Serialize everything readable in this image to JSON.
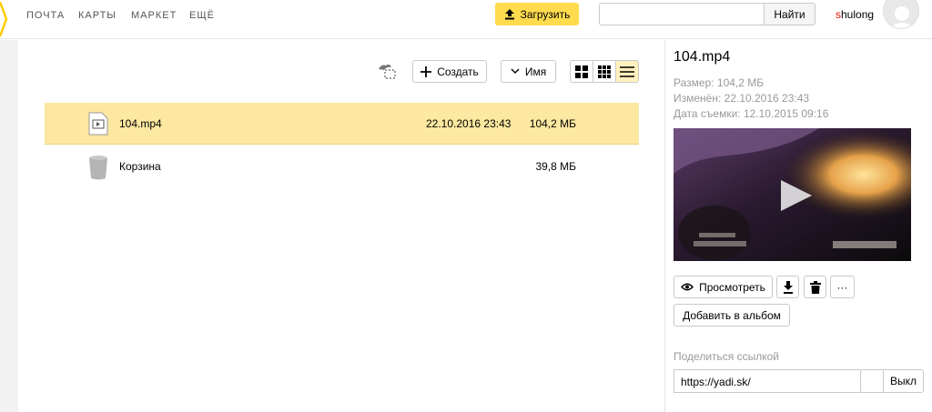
{
  "header": {
    "nav": [
      "ПОЧТА",
      "КАРТЫ",
      "МАРКЕТ",
      "ЕЩЁ"
    ],
    "upload_label": "Загрузить",
    "search_value": "",
    "search_button": "Найти",
    "user_first_letter": "s",
    "user_rest": "hulong"
  },
  "toolbar": {
    "create_label": "Создать",
    "sort_label": "Имя"
  },
  "files": [
    {
      "name": "104.mp4",
      "date": "22.10.2016 23:43",
      "size": "104,2 МБ",
      "icon": "video-file-icon"
    },
    {
      "name": "Корзина",
      "date": "",
      "size": "39,8 МБ",
      "icon": "trash-bin-icon"
    }
  ],
  "details": {
    "title": "104.mp4",
    "size_line": "Размер: 104,2 МБ",
    "modified_line": "Изменён: 22.10.2016 23:43",
    "shot_line": "Дата съемки: 12.10.2015 09:16",
    "view_label": "Просмотреть",
    "album_label": "Добавить в альбом",
    "share_label": "Поделиться ссылкой",
    "share_url": "https://yadi.sk/",
    "off_label": "Выкл",
    "more_label": "···"
  },
  "colors": {
    "accent_yellow": "#ffdb4d",
    "selected_row": "#fce8a0",
    "username_red": "#e61400"
  }
}
